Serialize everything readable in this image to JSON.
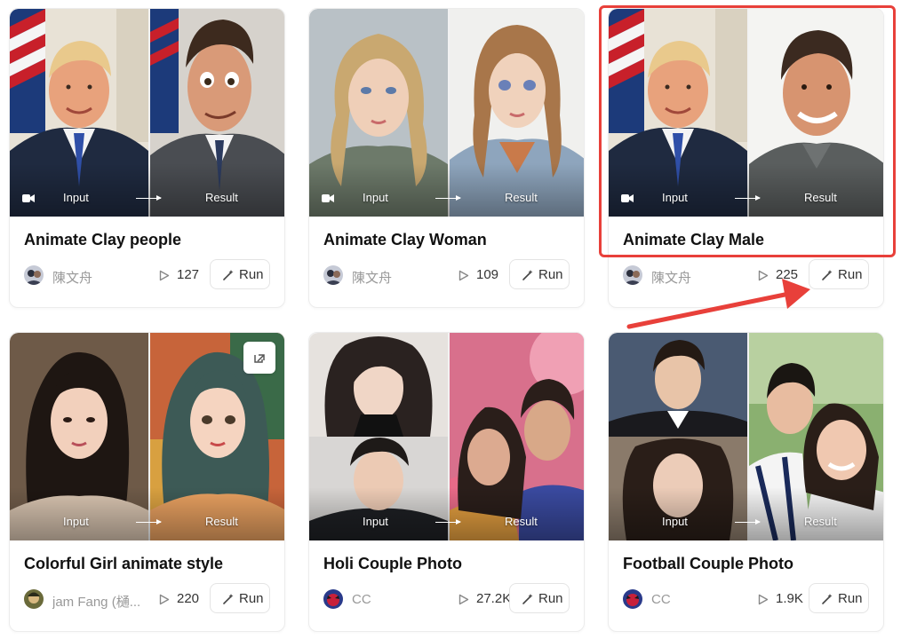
{
  "labels": {
    "input": "Input",
    "result": "Result",
    "run": "Run"
  },
  "colors": {
    "highlight": "#e8403a",
    "title": "#111111",
    "muted": "#999999"
  },
  "cards": [
    {
      "title": "Animate Clay people",
      "author": "陳文舟",
      "count": "127"
    },
    {
      "title": "Animate Clay Woman",
      "author": "陳文舟",
      "count": "109"
    },
    {
      "title": "Animate Clay Male",
      "author": "陳文舟",
      "count": "225"
    },
    {
      "title": "Colorful Girl animate style",
      "author": "jam Fang (樋...",
      "count": "220"
    },
    {
      "title": "Holi Couple Photo",
      "author": "CC",
      "count": "27.2K"
    },
    {
      "title": "Football Couple Photo",
      "author": "CC",
      "count": "1.9K"
    }
  ],
  "annotations": {
    "highlighted_card": "Animate Clay Male",
    "arrow_target": "run-button"
  }
}
